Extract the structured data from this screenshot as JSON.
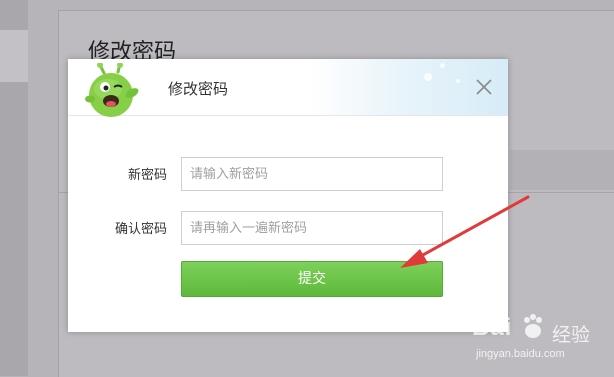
{
  "background": {
    "page_title": "修改密码"
  },
  "dialog": {
    "title": "修改密码",
    "new_password_label": "新密码",
    "new_password_placeholder": "请输入新密码",
    "new_password_value": "",
    "confirm_password_label": "确认密码",
    "confirm_password_placeholder": "请再输入一遍新密码",
    "confirm_password_value": "",
    "submit_label": "提交",
    "mascot_icon": "green-mascot-icon",
    "close_icon": "close-icon"
  },
  "annotation": {
    "arrow_color": "#e03a3a"
  },
  "watermark": {
    "brand": "Bai",
    "brand_cn": "经验",
    "url": "jingyan.baidu.com"
  },
  "colors": {
    "submit_green": "#5eb83b",
    "overlay_gray": "#b6b4b8"
  }
}
